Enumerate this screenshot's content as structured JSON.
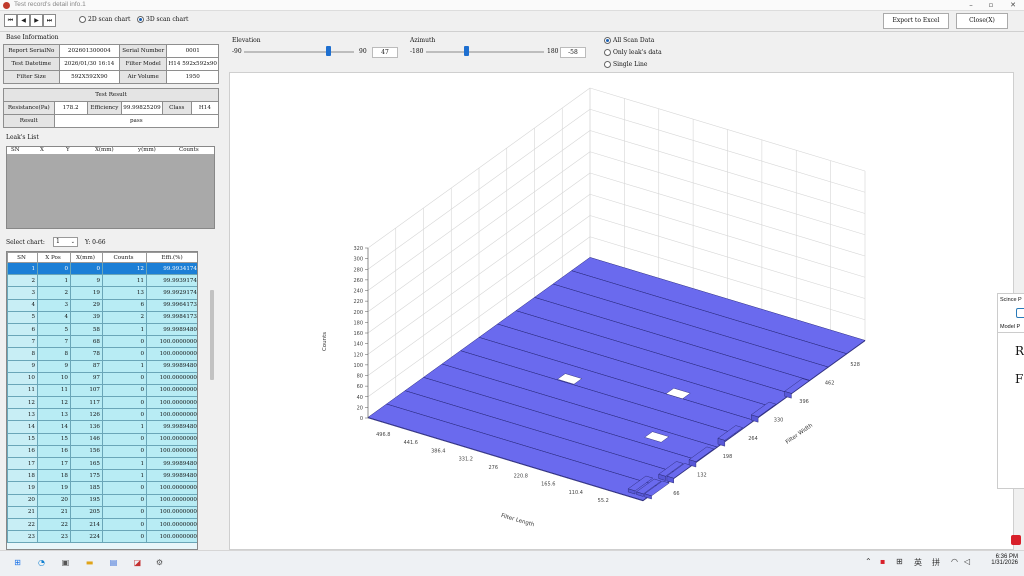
{
  "window": {
    "title": "Test record's detail info.1"
  },
  "toolbar": {
    "nav": [
      "⏮",
      "◀",
      "▶",
      "⏭"
    ],
    "chart_modes": [
      "2D scan chart",
      "3D scan chart"
    ],
    "selected_chart_mode": "3D scan chart",
    "export_label": "Export to Excel",
    "close_label": "Close(X)"
  },
  "base_info": {
    "title": "Base Information",
    "report_serial_label": "Report SerialNo",
    "report_serial_value": "202601300004",
    "serial_number_label": "Serial Number",
    "serial_number_value": "0001",
    "test_datetime_label": "Test Datetime",
    "test_datetime_value": "2026/01/30 16:14",
    "filter_model_label": "Filter Model",
    "filter_model_value": "H14 592x592x90",
    "filter_size_label": "Filter Size",
    "filter_size_value": "592X592X90",
    "air_volume_label": "Air Volume",
    "air_volume_value": "1950",
    "test_result_title": "Test Result",
    "resistance_label": "Resistance(Pa)",
    "resistance_value": "178.2",
    "efficiency_label": "Efficiency",
    "efficiency_value": "99.99825209",
    "class_label": "Class",
    "class_value": "H14",
    "result_label": "Result",
    "result_value": "pass"
  },
  "leaks": {
    "title": "Leak's List",
    "columns": [
      "SN",
      "X",
      "Y",
      "X(mm)",
      "y(mm)",
      "Counts"
    ]
  },
  "select_chart": {
    "label": "Select chart:",
    "value": "1",
    "y_range": "Y: 0-66"
  },
  "grid": {
    "columns": [
      "SN",
      "X Pos",
      "X(mm)",
      "Counts",
      "Effi.(%)"
    ],
    "rows": [
      [
        "1",
        "0",
        "0",
        "12",
        "99.9934174"
      ],
      [
        "2",
        "1",
        "9",
        "11",
        "99.9939174"
      ],
      [
        "3",
        "2",
        "19",
        "13",
        "99.9929174"
      ],
      [
        "4",
        "3",
        "29",
        "6",
        "99.9964173"
      ],
      [
        "5",
        "4",
        "39",
        "2",
        "99.9984173"
      ],
      [
        "6",
        "5",
        "58",
        "1",
        "99.9989480"
      ],
      [
        "7",
        "7",
        "68",
        "0",
        "100.0000000"
      ],
      [
        "8",
        "8",
        "78",
        "0",
        "100.0000000"
      ],
      [
        "9",
        "9",
        "87",
        "1",
        "99.9989480"
      ],
      [
        "10",
        "10",
        "97",
        "0",
        "100.0000000"
      ],
      [
        "11",
        "11",
        "107",
        "0",
        "100.0000000"
      ],
      [
        "12",
        "12",
        "117",
        "0",
        "100.0000000"
      ],
      [
        "13",
        "13",
        "126",
        "0",
        "100.0000000"
      ],
      [
        "14",
        "14",
        "136",
        "1",
        "99.9989480"
      ],
      [
        "15",
        "15",
        "146",
        "0",
        "100.0000000"
      ],
      [
        "16",
        "16",
        "156",
        "0",
        "100.0000000"
      ],
      [
        "17",
        "17",
        "165",
        "1",
        "99.9989480"
      ],
      [
        "18",
        "18",
        "175",
        "1",
        "99.9989480"
      ],
      [
        "19",
        "19",
        "185",
        "0",
        "100.0000000"
      ],
      [
        "20",
        "20",
        "195",
        "0",
        "100.0000000"
      ],
      [
        "21",
        "21",
        "205",
        "0",
        "100.0000000"
      ],
      [
        "22",
        "22",
        "214",
        "0",
        "100.0000000"
      ],
      [
        "23",
        "23",
        "224",
        "0",
        "100.0000000"
      ]
    ]
  },
  "view": {
    "elevation_label": "Elevation",
    "elevation_min": "-90",
    "elevation_max": "90",
    "elevation_value": "47",
    "elevation_fraction": 0.76,
    "azimuth_label": "Azimuth",
    "azimuth_min": "-180",
    "azimuth_max": "180",
    "azimuth_value": "-58",
    "azimuth_fraction": 0.34,
    "data_options": [
      "All Scan Data",
      "Only leak's data",
      "Single Line"
    ],
    "selected_data_option": "All Scan Data"
  },
  "chart_data": {
    "type": "bar3d",
    "title": "",
    "zlabel": "Counts",
    "xlabel": "Filter Length",
    "ylabel": "Filter Width",
    "z_ticks": [
      "0",
      "20",
      "40",
      "60",
      "80",
      "100",
      "120",
      "140",
      "160",
      "180",
      "200",
      "220",
      "240",
      "260",
      "280",
      "300",
      "320"
    ],
    "length_ticks": [
      "496.8",
      "441.6",
      "386.4",
      "331.2",
      "276",
      "220.8",
      "165.6",
      "110.4",
      "55.2"
    ],
    "width_ticks": [
      "66",
      "132",
      "198",
      "264",
      "330",
      "396",
      "462",
      "528"
    ],
    "zlim": [
      0,
      320
    ],
    "bar_color": "#6a6aee",
    "grid": true
  },
  "side_popup": {
    "header": "Scince P",
    "tab": "Model P",
    "line1": "Ra",
    "line2": "F"
  },
  "taskbar": {
    "ime": "英",
    "ime2": "拼",
    "time": "6:36 PM",
    "date": "1/31/2026"
  }
}
